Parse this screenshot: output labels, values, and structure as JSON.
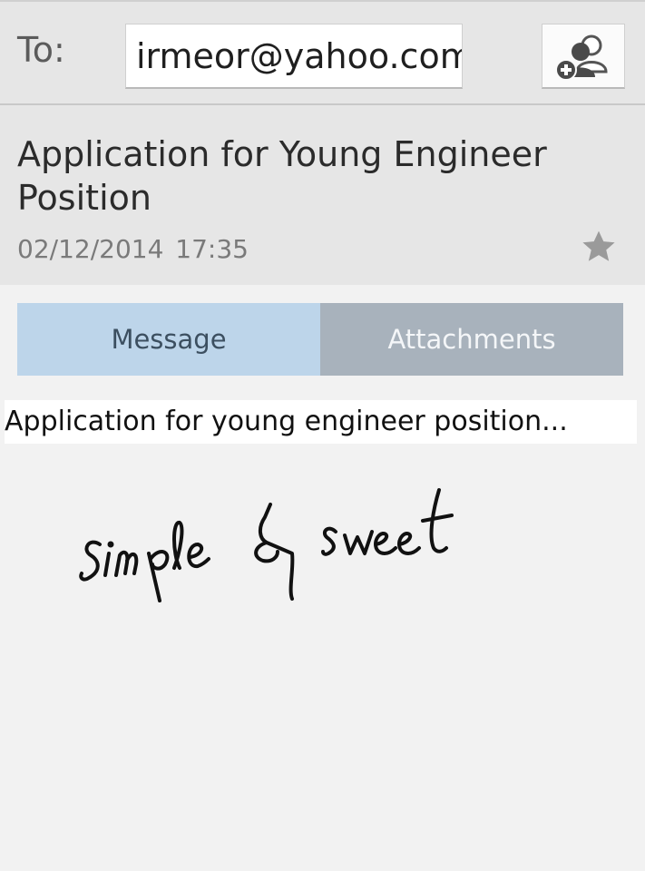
{
  "compose": {
    "to_label": "To:",
    "recipient": "irmeor@yahoo.com",
    "add_contact_icon": "add-contact-icon"
  },
  "email": {
    "subject": "Application for Young Engineer Position",
    "date": "02/12/2014",
    "time": "17:35",
    "starred": false,
    "star_icon": "star-icon"
  },
  "tabs": [
    {
      "label": "Message",
      "selected": true,
      "color": "#bdd5ea"
    },
    {
      "label": "Attachments",
      "selected": false,
      "color": "#a8b2bc"
    }
  ],
  "body": {
    "text": "Application for young engineer position...",
    "handwritten_note": "simple & sweet"
  }
}
